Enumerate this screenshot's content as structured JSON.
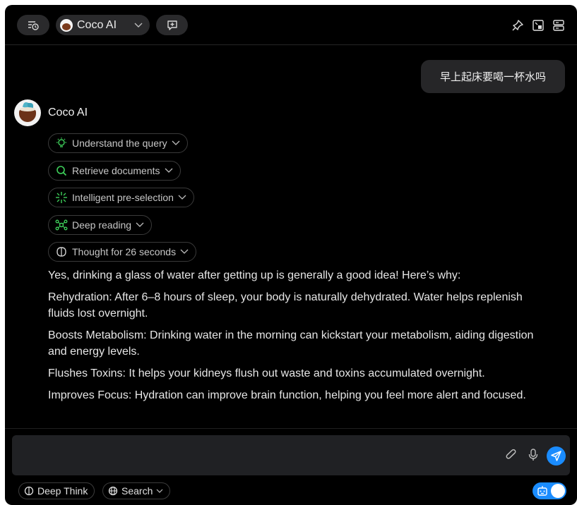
{
  "header": {
    "model_name": "Coco AI",
    "icons": [
      "history-icon",
      "chevron-down-icon",
      "new-chat-icon",
      "pin-icon",
      "window-icon",
      "server-icon"
    ]
  },
  "conversation": {
    "user_message": "早上起床要喝一杯水吗",
    "assistant_name": "Coco AI",
    "steps": [
      {
        "label": "Understand the query",
        "icon": "lightbulb-icon"
      },
      {
        "label": "Retrieve documents",
        "icon": "search-icon"
      },
      {
        "label": "Intelligent pre-selection",
        "icon": "sparkle-icon"
      },
      {
        "label": "Deep reading",
        "icon": "network-icon"
      },
      {
        "label": "Thought for 26 seconds",
        "icon": "brain-icon"
      }
    ],
    "answer": [
      "Yes, drinking a glass of water after getting up is generally a good idea! Here’s why:",
      "Rehydration: After 6–8 hours of sleep, your body is naturally dehydrated. Water helps replenish fluids lost overnight.",
      "Boosts Metabolism: Drinking water in the morning can kickstart your metabolism, aiding digestion and energy levels.",
      "Flushes Toxins: It helps your kidneys flush out waste and toxins accumulated overnight.",
      "Improves Focus: Hydration can improve brain function, helping you feel more alert and focused."
    ]
  },
  "composer": {
    "value": "",
    "icons": [
      "attach-icon",
      "mic-icon",
      "send-icon"
    ]
  },
  "footer": {
    "deep_think_label": "Deep Think",
    "search_label": "Search",
    "assistant_mode_on": true
  },
  "colors": {
    "background": "#000000",
    "accent": "#1a8cff",
    "step_icon_green": "#3ecf5a"
  }
}
